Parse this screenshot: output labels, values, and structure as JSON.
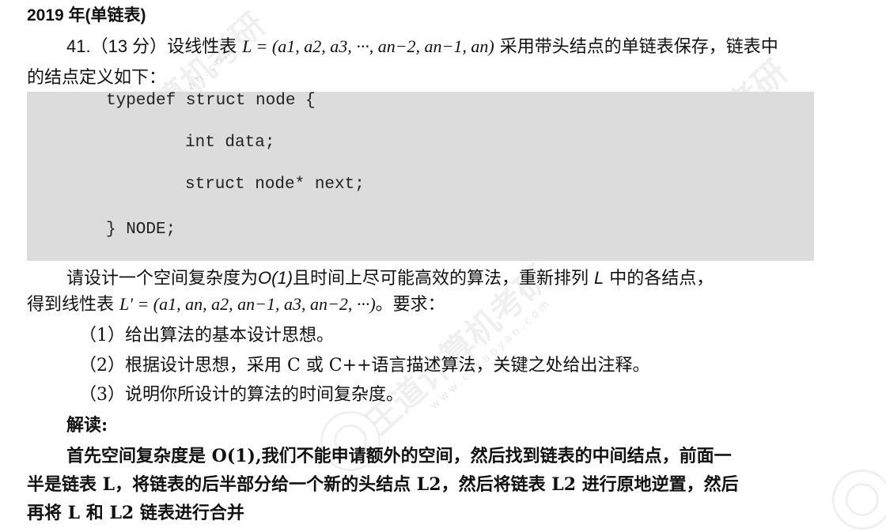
{
  "heading": "2019 年(单链表)",
  "question": {
    "number": "41.",
    "score": "（13 分）",
    "intro": "设线性表",
    "definition": "L = (a1, a2, a3, ···, an−2, an−1, an)",
    "tail": "采用带头结点的单链表保存，链表中",
    "line2": "的结点定义如下："
  },
  "code": {
    "line1": "typedef struct node {",
    "line2": "int data;",
    "line3": "struct node* next;",
    "line4": "} NODE;"
  },
  "task": {
    "line1_prefix": "请设计一个空间复杂度为",
    "complexity": "O(1)",
    "line1_mid": "且时间上尽可能高效的算法，重新排列",
    "list_name": "L",
    "line1_suffix": "中的各结点，",
    "line2_prefix": "得到线性表",
    "target": "L' = (a1, an, a2, an−1, a3, an−2, ···)",
    "line2_suffix": "。要求："
  },
  "requirements": [
    "（1）给出算法的基本设计思想。",
    "（2）根据设计思想，采用 C 或 C++语言描述算法，关键之处给出注释。",
    "（3）说明你所设计的算法的时间复杂度。"
  ],
  "answer": {
    "label": "解读:",
    "line1": "首先空间复杂度是 O(1),我们不能申请额外的空间，然后找到链表的中间结点，前面一",
    "line2": "半是链表 L，将链表的后半部分给一个新的头结点 L2，然后将链表 L2 进行原地逆置，然后",
    "line3": "再将 L 和 L2 链表进行合并"
  },
  "watermark": {
    "brand": "王道计算机考研",
    "url": "www.cskaoyan.com"
  }
}
